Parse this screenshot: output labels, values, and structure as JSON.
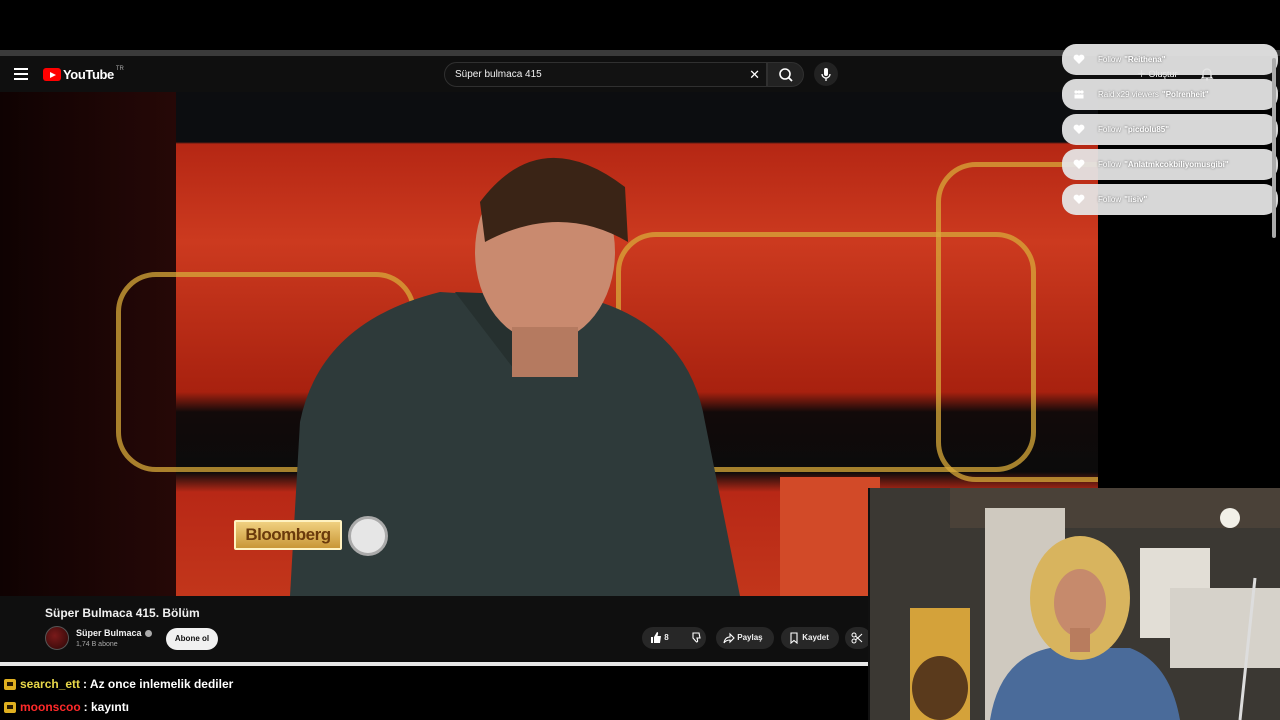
{
  "youtube": {
    "logo_text": "YouTube",
    "region": "TR",
    "search_query": "Süper bulmaca 415",
    "create_label": "Oluştur"
  },
  "video": {
    "title": "Süper Bulmaca 415. Bölüm",
    "channel_name": "Süper Bulmaca",
    "subscribers": "1,74 B abone",
    "subscribe_label": "Abone ol",
    "like_count": "8",
    "share_label": "Paylaş",
    "save_label": "Kaydet",
    "overlay_text": "Bloomberg"
  },
  "alerts": [
    {
      "type": "Follow",
      "icon": "heart-icon",
      "name": "\"Reithena\""
    },
    {
      "type": "Raid x29 viewers",
      "icon": "raid-icon",
      "name": "\"Polrenheit\""
    },
    {
      "type": "Follow",
      "icon": "heart-icon",
      "name": "\"picdolu85\""
    },
    {
      "type": "Follow",
      "icon": "heart-icon",
      "name": "\"Anlatmkcokbiliyomusgibi\""
    },
    {
      "type": "Follow",
      "icon": "heart-icon",
      "name": "\"lisiv\""
    }
  ],
  "chat": [
    {
      "user": "search_ett",
      "text": ": Az once inlemelik dediler",
      "color": "#e8d84a"
    },
    {
      "user": "moonscoo",
      "text": ": kayıntı",
      "color": "#ff2a2a"
    }
  ]
}
